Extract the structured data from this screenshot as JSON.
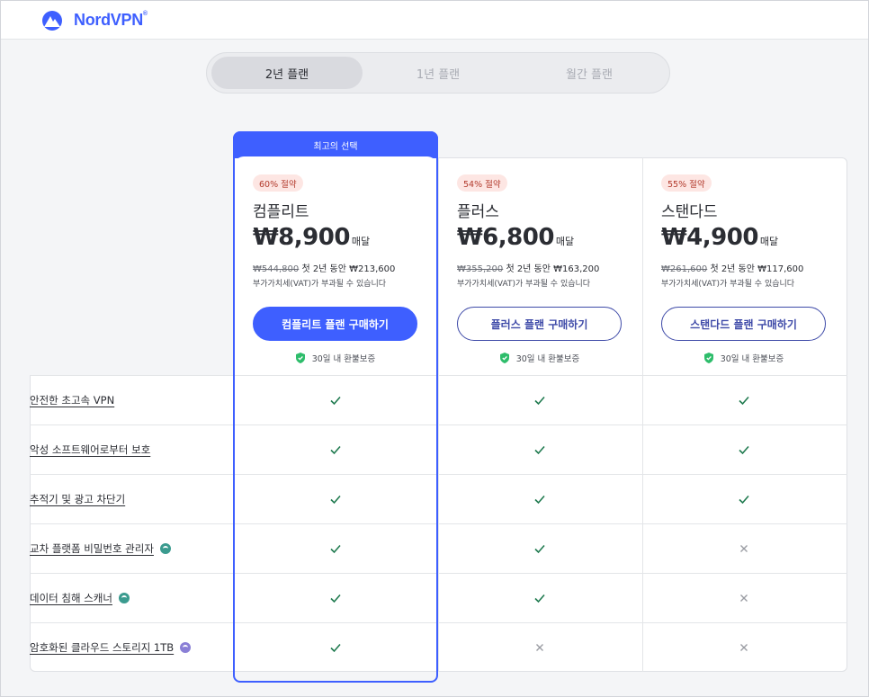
{
  "header": {
    "brand": "NordVPN",
    "brand_mark": "®"
  },
  "tabs": [
    {
      "label": "2년 플랜",
      "active": true
    },
    {
      "label": "1년 플랜",
      "active": false
    },
    {
      "label": "월간 플랜",
      "active": false
    }
  ],
  "ribbon": "최고의 선택",
  "plans": [
    {
      "save": "60% 절약",
      "name": "컴플리트",
      "price": "₩8,900",
      "unit": "매달",
      "old_price": "₩544,800",
      "billing": "첫 2년 동안 ₩213,600",
      "vat": "부가가치세(VAT)가 부과될 수 있습니다",
      "cta": "컴플리트 플랜 구매하기",
      "refund": "30일 내 환불보증"
    },
    {
      "save": "54% 절약",
      "name": "플러스",
      "price": "₩6,800",
      "unit": "매달",
      "old_price": "₩355,200",
      "billing": "첫 2년 동안 ₩163,200",
      "vat": "부가가치세(VAT)가 부과될 수 있습니다",
      "cta": "플러스 플랜 구매하기",
      "refund": "30일 내 환불보증"
    },
    {
      "save": "55% 절약",
      "name": "스탠다드",
      "price": "₩4,900",
      "unit": "매달",
      "old_price": "₩261,600",
      "billing": "첫 2년 동안 ₩117,600",
      "vat": "부가가치세(VAT)가 부과될 수 있습니다",
      "cta": "스탠다드 플랜 구매하기",
      "refund": "30일 내 환불보증"
    }
  ],
  "features": [
    {
      "label": "안전한 초고속 VPN",
      "icon": "",
      "included": [
        true,
        true,
        true
      ]
    },
    {
      "label": "악성 소프트웨어로부터 보호",
      "icon": "",
      "included": [
        true,
        true,
        true
      ]
    },
    {
      "label": "추적기 및 광고 차단기",
      "icon": "",
      "included": [
        true,
        true,
        true
      ]
    },
    {
      "label": "교차 플랫폼 비밀번호 관리자",
      "icon": "nordpass-icon",
      "included": [
        true,
        true,
        false
      ]
    },
    {
      "label": "데이터 침해 스캐너",
      "icon": "nordpass-icon",
      "included": [
        true,
        true,
        false
      ]
    },
    {
      "label": "암호화된 클라우드 스토리지 1TB",
      "icon": "nordlocker-icon",
      "included": [
        true,
        false,
        false
      ]
    }
  ],
  "colors": {
    "accent": "#3e5fff",
    "check": "#1f7a4f",
    "cross": "#9a9ca3",
    "shield": "#2ebd6b"
  }
}
